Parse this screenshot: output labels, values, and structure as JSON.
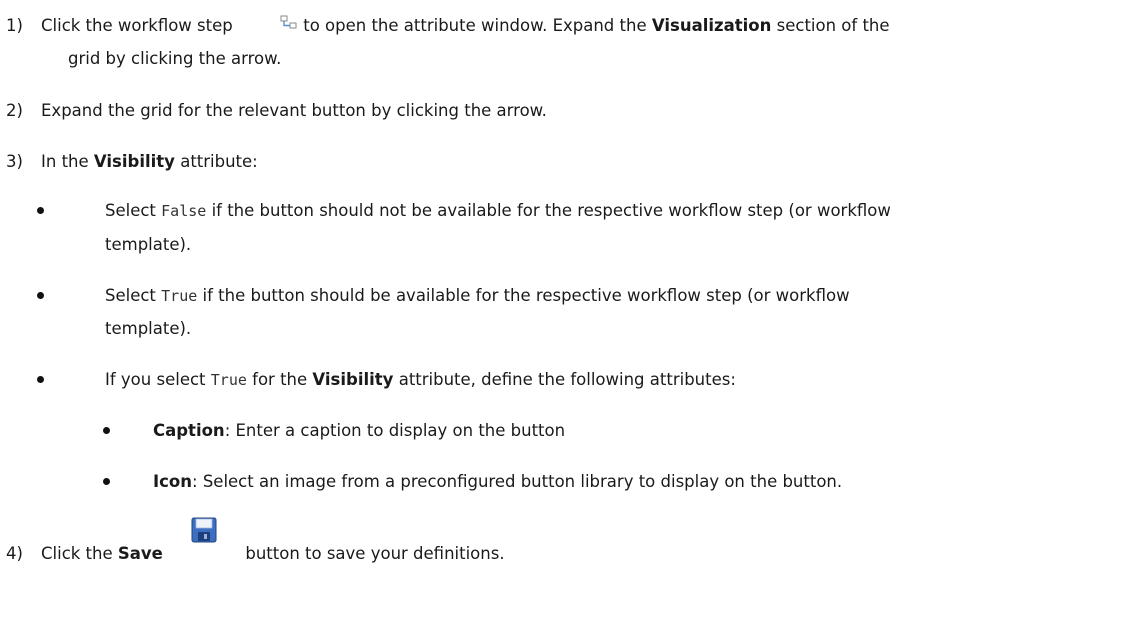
{
  "steps": [
    {
      "num": "1)",
      "a": "Click the workflow step",
      "b": "to open the attribute window. Expand the",
      "bold": "Visualization",
      "c": "section of the",
      "d": "grid by clicking the arrow."
    },
    {
      "num": "2)",
      "a": "Expand the grid for the relevant button by clicking the arrow."
    },
    {
      "num": "3)",
      "a": "In the",
      "bold": "Visibility",
      "b": "attribute:"
    },
    {
      "num": "4)",
      "a": "Click the",
      "bold": "Save",
      "b": "button to save your definitions."
    }
  ],
  "bullets": [
    {
      "a": "Select",
      "code": "False",
      "b": "if the button should not be available for the respective workflow step (or workflow",
      "c": "template)."
    },
    {
      "a": "Select",
      "code": "True",
      "b": "if the button should be available for the respective workflow step (or workflow",
      "c": "template)."
    },
    {
      "a": "If you select",
      "code": "True",
      "b": "for the",
      "bold": "Visibility",
      "c": "attribute, define the following attributes:"
    }
  ],
  "subbullets": [
    {
      "bold": "Caption",
      "text": ": Enter a caption to display on the button"
    },
    {
      "bold": "Icon",
      "text": ": Select an image from a preconfigured button library to display on the button."
    }
  ],
  "icons": {
    "workflow_step": "workflow-step-icon",
    "save": "floppy-save-icon"
  }
}
